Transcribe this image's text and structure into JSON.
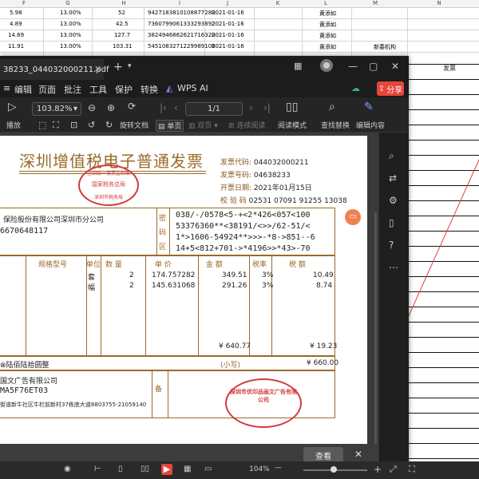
{
  "sheet": {
    "col_headers": [
      "F",
      "G",
      "H",
      "I",
      "J",
      "K",
      "L",
      "M",
      "N"
    ],
    "rows": [
      {
        "a": "5.98",
        "b": "13.00%",
        "c": "52",
        "d": "9427183810108877280",
        "e": "2021-01-16",
        "f": "黄添如"
      },
      {
        "a": "4.89",
        "b": "13.00%",
        "c": "42.5",
        "d": "7360799061333293892",
        "e": "2021-01-16",
        "f": "黄添如"
      },
      {
        "a": "14.69",
        "b": "13.00%",
        "c": "127.7",
        "d": "3824946862621716320",
        "e": "2021-01-16",
        "f": "黄添如"
      },
      {
        "a": "11.91",
        "b": "13.00%",
        "c": "103.31",
        "d": "5451083271229989106",
        "e": "2021-01-16",
        "f": "黄添如",
        "g": "新委机构"
      }
    ],
    "right_header": "发票",
    "diag_color": "#e04040"
  },
  "viewer": {
    "tab_title": "38233_044032000211.pdf",
    "menu": [
      "编辑",
      "页面",
      "批注",
      "工具",
      "保护",
      "转换"
    ],
    "wps_ai": "WPS AI",
    "share": "分享",
    "zoom": "103.82%",
    "page_indicator": "1/1",
    "tools": {
      "play": "播放",
      "rotate": "旋转文档",
      "single": "单页",
      "double": "双页",
      "continuous": "连续阅读",
      "read_mode": "阅读模式",
      "find_replace": "查找替换",
      "edit_content": "编辑内容"
    },
    "popup_view": "查看",
    "status_zoom": "104%",
    "accent": "#e8443a"
  },
  "invoice": {
    "title": "深圳增值税电子普通发票",
    "seal_top": "全国统一发票监制章",
    "seal_mid": "国家税务总局",
    "seal_bottom": "深圳市税务局",
    "code_label": "发票代码:",
    "code": "044032000211",
    "number_label": "发票号码:",
    "number": "04638233",
    "date_label": "开票日期:",
    "date": "2021年01月15日",
    "check_label": "校  验  码",
    "check": "02531 07091 91255 13038",
    "buyer_name": "保险股份有限公司深圳市分公司",
    "buyer_tax": "6670648117",
    "cipher_label_1": "密",
    "cipher_label_2": "码",
    "cipher_label_3": "区",
    "cipher": [
      "038/-/0578<5-+<2*426<057<100",
      "53376360**<38191/<>>/62-51/<",
      "1*>1606-54924**>>>-*8->851--6",
      "14+5<812+701->*4196>>*43>-70"
    ],
    "col_spec": "规格型号",
    "col_unit": "单位",
    "col_qty": "数  量",
    "col_price": "单  价",
    "col_amount": "金  额",
    "col_rate": "税率",
    "col_tax": "税  额",
    "items": [
      {
        "unit": "套",
        "qty": "2",
        "price": "174.757282",
        "amount": "349.51",
        "rate": "3%",
        "tax": "10.49"
      },
      {
        "unit": "幅",
        "qty": "2",
        "price": "145.631068",
        "amount": "291.26",
        "rate": "3%",
        "tax": "8.74"
      }
    ],
    "subtotal_amount": "¥ 640.77",
    "subtotal_tax": "¥ 19.23",
    "total_words": "⊗陆佰陆拾圆整",
    "total_small_label": "(小写)",
    "total_small": "¥ 660.00",
    "seller_name": "国文广告有限公司",
    "seller_tax": "MA5F76ET03",
    "seller_addr": "街道新牛社区牛栏前新村37栋底大道8803755-21059140",
    "remark_label": "备",
    "seller_seal": "深圳市优印品画文广告有限公司"
  }
}
